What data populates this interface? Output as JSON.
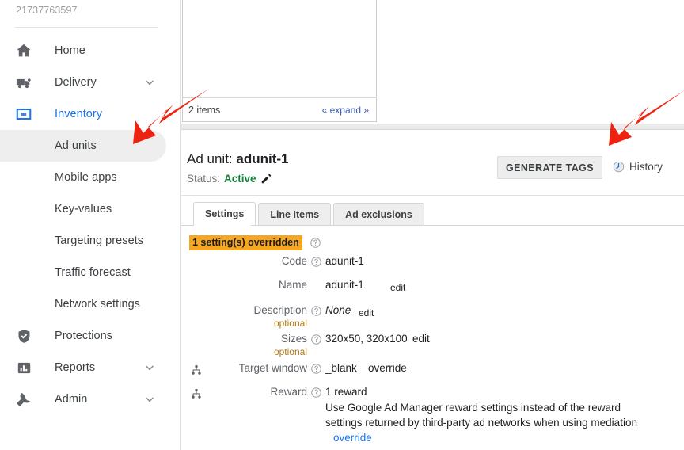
{
  "sidebar": {
    "account_id": "21737763597",
    "items": [
      {
        "label": "Home",
        "icon": "home-icon",
        "type": "top",
        "chevron": false,
        "active": false
      },
      {
        "label": "Delivery",
        "icon": "truck-icon",
        "type": "top",
        "chevron": true,
        "active": false
      },
      {
        "label": "Inventory",
        "icon": "inventory-icon",
        "type": "top",
        "chevron": false,
        "active": true
      },
      {
        "label": "Ad units",
        "icon": "",
        "type": "sub",
        "chevron": false,
        "selected": true
      },
      {
        "label": "Mobile apps",
        "icon": "",
        "type": "sub",
        "chevron": false,
        "selected": false
      },
      {
        "label": "Key-values",
        "icon": "",
        "type": "sub",
        "chevron": false,
        "selected": false
      },
      {
        "label": "Targeting presets",
        "icon": "",
        "type": "sub",
        "chevron": false,
        "selected": false
      },
      {
        "label": "Traffic forecast",
        "icon": "",
        "type": "sub",
        "chevron": false,
        "selected": false
      },
      {
        "label": "Network settings",
        "icon": "",
        "type": "sub",
        "chevron": false,
        "selected": false
      },
      {
        "label": "Protections",
        "icon": "shield-check-icon",
        "type": "top",
        "chevron": false,
        "active": false
      },
      {
        "label": "Reports",
        "icon": "bar-chart-icon",
        "type": "top",
        "chevron": true,
        "active": false
      },
      {
        "label": "Admin",
        "icon": "wrench-icon",
        "type": "top",
        "chevron": true,
        "active": false
      }
    ]
  },
  "tree_panel": {
    "item_count_label": "2 items",
    "expand_label": "« expand »"
  },
  "detail": {
    "title_prefix": "Ad unit:",
    "title_name": "adunit-1",
    "status_label": "Status:",
    "status_value": "Active",
    "edit_pencil_icon": "pencil-icon",
    "generate_tags_label": "GENERATE TAGS",
    "history_label": "History",
    "history_icon": "clock-history-icon",
    "tabs": [
      {
        "label": "Settings",
        "active": true
      },
      {
        "label": "Line Items",
        "active": false
      },
      {
        "label": "Ad exclusions",
        "active": false
      }
    ],
    "override_badge": "1 setting(s) overridden",
    "override_help_icon": "help-circle-icon",
    "settings": [
      {
        "label": "Code",
        "optional": "",
        "tree_icon": false,
        "value": "adunit-1",
        "italic": false,
        "link": "",
        "desc": "",
        "desc_link": ""
      },
      {
        "label": "Name",
        "optional": "",
        "tree_icon": false,
        "value": "adunit-1",
        "italic": false,
        "link": "edit",
        "desc": "",
        "desc_link": ""
      },
      {
        "label": "Description",
        "optional": "optional",
        "tree_icon": false,
        "value": "None",
        "italic": true,
        "link": "edit",
        "desc": "",
        "desc_link": ""
      },
      {
        "label": "Sizes",
        "optional": "optional",
        "tree_icon": false,
        "value": "320x50, 320x100",
        "italic": false,
        "link": "edit",
        "desc": "",
        "desc_link": ""
      },
      {
        "label": "Target window",
        "optional": "",
        "tree_icon": true,
        "value": "_blank",
        "italic": false,
        "link": "override",
        "desc": "",
        "desc_link": ""
      },
      {
        "label": "Reward",
        "optional": "",
        "tree_icon": true,
        "value": "1 reward",
        "italic": false,
        "link": "",
        "desc": "Use Google Ad Manager reward settings instead of the reward settings returned by third-party ad networks when using mediation",
        "desc_link": "override"
      }
    ]
  },
  "annotations": {
    "arrow_color": "#ee2211",
    "arrow_1_target": "sidebar-item-ad-units",
    "arrow_2_target": "generate-tags-button"
  },
  "colors": {
    "accent_link": "#1a73e8",
    "status_green": "#188038",
    "badge_orange": "#f5a623",
    "optional_amber": "#b07915",
    "arrow_red": "#ee2211"
  }
}
